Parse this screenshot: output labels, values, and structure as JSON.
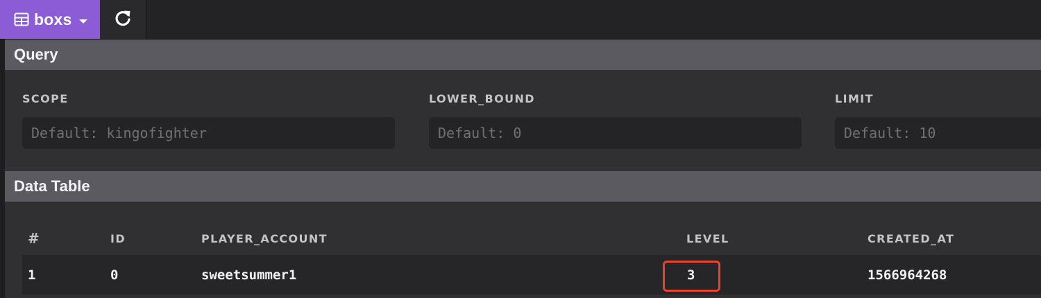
{
  "toolbar": {
    "table_name": "boxs",
    "table_icon": "table-grid-icon",
    "caret_icon": "caret-down-icon",
    "refresh_icon": "refresh-icon",
    "accent_color": "#8b5cd6"
  },
  "query": {
    "title": "Query",
    "fields": [
      {
        "label": "SCOPE",
        "placeholder": "Default: kingofighter"
      },
      {
        "label": "LOWER_BOUND",
        "placeholder": "Default: 0"
      },
      {
        "label": "LIMIT",
        "placeholder": "Default: 10"
      }
    ]
  },
  "data_table": {
    "title": "Data Table",
    "columns": [
      "#",
      "ID",
      "PLAYER_ACCOUNT",
      "LEVEL",
      "CREATED_AT"
    ],
    "rows": [
      [
        "1",
        "0",
        "sweetsummer1",
        "3",
        "1566964268"
      ]
    ],
    "highlight_color": "#e8442a"
  }
}
